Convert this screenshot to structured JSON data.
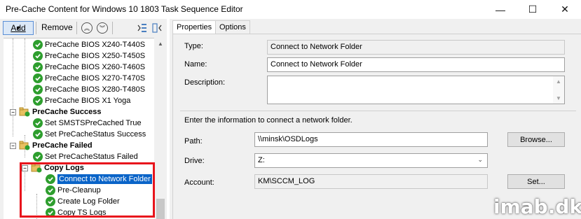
{
  "window": {
    "title": "Pre-Cache Content for Windows 10 1803 Task Sequence Editor",
    "minimize": "—",
    "maximize": "☐",
    "close": "✕"
  },
  "toolbar": {
    "add_label": "Add",
    "remove_label": "Remove",
    "move_up_icon": "chevron-up-circle-icon",
    "move_down_icon": "chevron-down-circle-icon"
  },
  "tree": {
    "items": [
      {
        "label": "PreCache BIOS X240-T440S",
        "status": "success"
      },
      {
        "label": "PreCache BIOS X250-T450S",
        "status": "success"
      },
      {
        "label": "PreCache BIOS X260-T460S",
        "status": "success"
      },
      {
        "label": "PreCache BIOS X270-T470S",
        "status": "success"
      },
      {
        "label": "PreCache BIOS X280-T480S",
        "status": "success"
      },
      {
        "label": "PreCache BIOS X1 Yoga",
        "status": "success"
      },
      {
        "label": "PreCache Success",
        "type": "group"
      },
      {
        "label": "Set SMSTSPreCached True",
        "status": "success"
      },
      {
        "label": "Set PreCacheStatus Success",
        "status": "success"
      },
      {
        "label": "PreCache Failed",
        "type": "group"
      },
      {
        "label": "Set PreCacheStatus Failed",
        "status": "success"
      },
      {
        "label": "Copy Logs",
        "type": "group"
      },
      {
        "label": "Connect to Network Folder",
        "status": "success",
        "selected": true
      },
      {
        "label": "Pre-Cleanup",
        "status": "success"
      },
      {
        "label": "Create Log Folder",
        "status": "success"
      },
      {
        "label": "Copy TS Logs",
        "status": "success"
      }
    ]
  },
  "tabs": [
    {
      "label": "Properties",
      "active": true
    },
    {
      "label": "Options",
      "active": false
    }
  ],
  "properties": {
    "type_label": "Type:",
    "type_value": "Connect to Network Folder",
    "name_label": "Name:",
    "name_value": "Connect to Network Folder",
    "description_label": "Description:",
    "description_value": "",
    "instructions": "Enter the information to connect a network folder.",
    "path_label": "Path:",
    "path_value": "\\\\minsk\\OSDLogs",
    "browse_label": "Browse...",
    "drive_label": "Drive:",
    "drive_value": "Z:",
    "account_label": "Account:",
    "account_value": "KM\\SCCM_LOG",
    "set_label": "Set..."
  },
  "watermark": "imab.dk",
  "colors": {
    "selection": "#0a64c8",
    "success_icon": "#2e9e2e",
    "highlight_box": "#e8141c",
    "folder": "#e8c060"
  }
}
